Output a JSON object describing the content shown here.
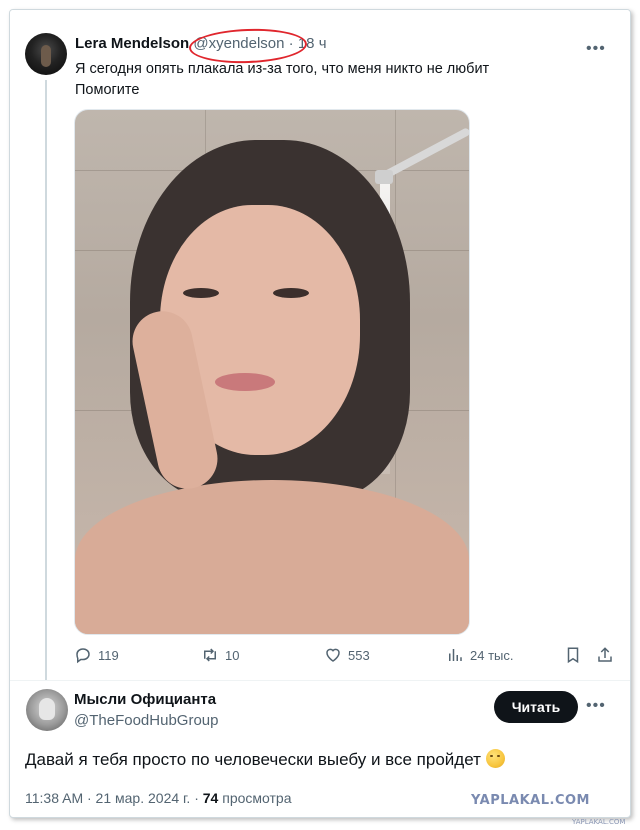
{
  "tweet": {
    "name": "Lera Mendelson",
    "handle": "@xyendelson",
    "separator": "·",
    "time": "18 ч",
    "text_line1": "Я сегодня опять плакала из-за того, что меня никто не любит",
    "text_line2": "Помогите",
    "more_icon": "more-dots-icon",
    "stats": {
      "replies": "119",
      "reposts": "10",
      "likes": "553",
      "views": "24 тыс."
    }
  },
  "reply": {
    "name": "Мысли Официанта",
    "handle": "@TheFoodHubGroup",
    "follow_label": "Читать",
    "text": "Давай я тебя просто по человечески выебу и все пройдет",
    "emoji": "hugging-face-emoji",
    "meta_time": "11:38 AM · 21 мар. 2024 г. · ",
    "meta_views": "74",
    "meta_views_label": " просмотра"
  },
  "watermark": {
    "main": "YAPLAKAL.COM",
    "sub": "YAPLAKAL.COM"
  },
  "colors": {
    "text": "#0f1419",
    "secondary": "#536471",
    "highlight_circle": "#e0262d",
    "button_bg": "#0f1419"
  }
}
